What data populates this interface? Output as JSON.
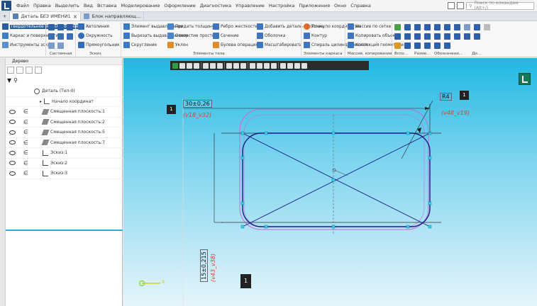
{
  "menu": [
    "Файл",
    "Правка",
    "Выделить",
    "Вид",
    "Вставка",
    "Моделирование",
    "Оформление",
    "Диагностика",
    "Управление",
    "Настройка",
    "Приложения",
    "Окно",
    "Справка"
  ],
  "search_placeholder": "Поиск по командам (Alt+/)",
  "tabs": [
    {
      "label": "Деталь БЕЗ ИМЕНИ1",
      "active": true
    },
    {
      "label": "Блок направляющ..."
    }
  ],
  "ribbon": {
    "col1": [
      "Твердотельное моделирование",
      "Каркас и поверхности",
      "Инструменты эскиза"
    ],
    "col2": [
      "Автолиния",
      "Окружность",
      "Прямоугольник"
    ],
    "col3": [
      "Элемент выдавливания",
      "Вырезать выдавливанием",
      "Скругление"
    ],
    "col4": [
      "Придать толщину",
      "Отверстие простое",
      "Уклон"
    ],
    "col5": [
      "Ребро жесткости",
      "Сечение",
      "Булева операция"
    ],
    "col6": [
      "Добавить деталь-заготовку",
      "Оболочка",
      "Масштабировать"
    ],
    "col7": [
      "Точка по координатам",
      "Контур",
      "Спираль цилиндрическая"
    ],
    "col8": [
      "Массив по сетке",
      "Копировать объекты",
      "Коллекция геометрии"
    ],
    "groups": [
      "Системная",
      "Эскиз",
      "Элементы тела",
      "Элементы каркаса",
      "Массив, копирование",
      "Вспо...",
      "Разме...",
      "Обозначени...",
      "Ди..."
    ]
  },
  "tree_panel": {
    "title": "Дерево",
    "items": [
      {
        "label": "Деталь (Тел-0)",
        "level": 0
      },
      {
        "label": "Начало координат",
        "level": 1
      },
      {
        "label": "Смещенная плоскость:1",
        "level": 1
      },
      {
        "label": "Смещенная плоскость:2",
        "level": 1
      },
      {
        "label": "Смещенная плоскость:5",
        "level": 1
      },
      {
        "label": "Смещенная плоскость:7",
        "level": 1
      },
      {
        "label": "Эскиз:1",
        "level": 1
      },
      {
        "label": "Эскиз:2",
        "level": 1
      },
      {
        "label": "Эскиз:3",
        "level": 1
      }
    ]
  },
  "drawing": {
    "dim_top_value": "30±0,26",
    "dim_top_var": "(v18_v32)",
    "dim_top_badge": "1",
    "dim_radius_value": "R4",
    "dim_radius_var": "(v48_v19)",
    "dim_radius_badge": "1",
    "dim_left_value": "15±0,215",
    "dim_left_var": "(v43_v38)",
    "dim_left_badge": "1",
    "axis_x_label": "X"
  },
  "colors": {
    "viewport_top": "#1fb8e2",
    "sketch_line": "#1a1a8a",
    "dim_text": "#e0402a",
    "ghost_contour": "#c66bd8",
    "tree_accent": "#27b2cc"
  }
}
